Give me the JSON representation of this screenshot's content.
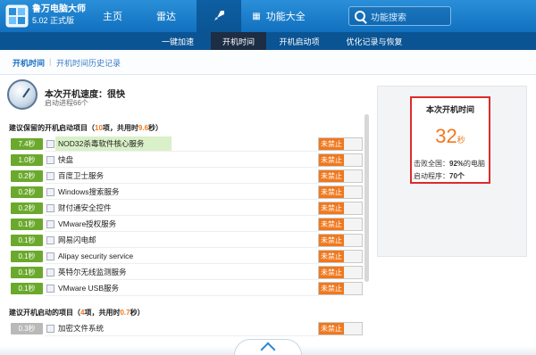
{
  "app": {
    "name": "鲁万电脑大师",
    "version": "5.02 正式版"
  },
  "nav": {
    "home": "主页",
    "radar": "雷达",
    "features": "功能大全"
  },
  "search": {
    "placeholder": "功能搜索"
  },
  "subtabs": [
    "一键加速",
    "开机时间",
    "开机启动项",
    "优化记录与恢复"
  ],
  "tabs2": {
    "active": "开机时间",
    "history": "开机时间历史记录"
  },
  "speed": {
    "title": "本次开机速度：很快",
    "subtitle": "启动进程66个"
  },
  "section1": {
    "prefix": "建议保留的开机启动项目（",
    "count": "10",
    "mid": "项，共用时",
    "time": "9.6",
    "suffix": "秒）"
  },
  "section2": {
    "prefix": "建议开机启动的项目（",
    "count": "4",
    "mid": "项，共用时",
    "time": "0.7",
    "suffix": "秒）"
  },
  "items": [
    {
      "time": "7.4秒",
      "name": "NOD32杀毒软件核心服务",
      "action": "未禁止"
    },
    {
      "time": "1.0秒",
      "name": "快盘",
      "action": "未禁止"
    },
    {
      "time": "0.2秒",
      "name": "百度卫士服务",
      "action": "未禁止"
    },
    {
      "time": "0.2秒",
      "name": "Windows搜索服务",
      "action": "未禁止"
    },
    {
      "time": "0.2秒",
      "name": "财付通安全控件",
      "action": "未禁止"
    },
    {
      "time": "0.1秒",
      "name": "VMware授权服务",
      "action": "未禁止"
    },
    {
      "time": "0.1秒",
      "name": "网易闪电邮",
      "action": "未禁止"
    },
    {
      "time": "0.1秒",
      "name": "Alipay security service",
      "action": "未禁止"
    },
    {
      "time": "0.1秒",
      "name": "英特尔无线监测服务",
      "action": "未禁止"
    },
    {
      "time": "0.1秒",
      "name": "VMware USB服务",
      "action": "未禁止"
    }
  ],
  "items2": [
    {
      "time": "0.3秒",
      "name": "加密文件系统",
      "action": "未禁止"
    }
  ],
  "boot": {
    "title": "本次开机时间",
    "seconds": "32",
    "unit": "秒",
    "beat_label": "击败全国：",
    "beat_value": "92%",
    "beat_suffix": "的电脑",
    "procs_label": "启动程序：",
    "procs_value": "70个"
  },
  "colors": {
    "accent": "#1170bf",
    "highlight": "#f0781e",
    "time_badge": "#6aa92c",
    "frame": "#e02a2a"
  }
}
